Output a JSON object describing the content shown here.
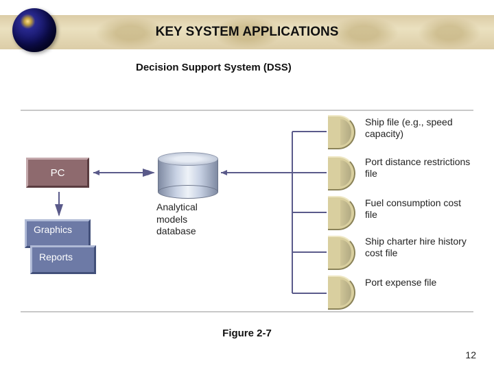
{
  "header": {
    "title": "KEY SYSTEM APPLICATIONS",
    "subtitle": "Decision Support System (DSS)"
  },
  "diagram": {
    "pc": "PC",
    "graphics": "Graphics",
    "reports": "Reports",
    "db_label": "Analytical models database",
    "files": [
      "Ship file (e.g., speed capacity)",
      "Port distance restrictions file",
      "Fuel consumption cost file",
      "Ship charter hire history cost file",
      "Port expense file"
    ]
  },
  "caption": "Figure 2-7",
  "page_number": "12"
}
